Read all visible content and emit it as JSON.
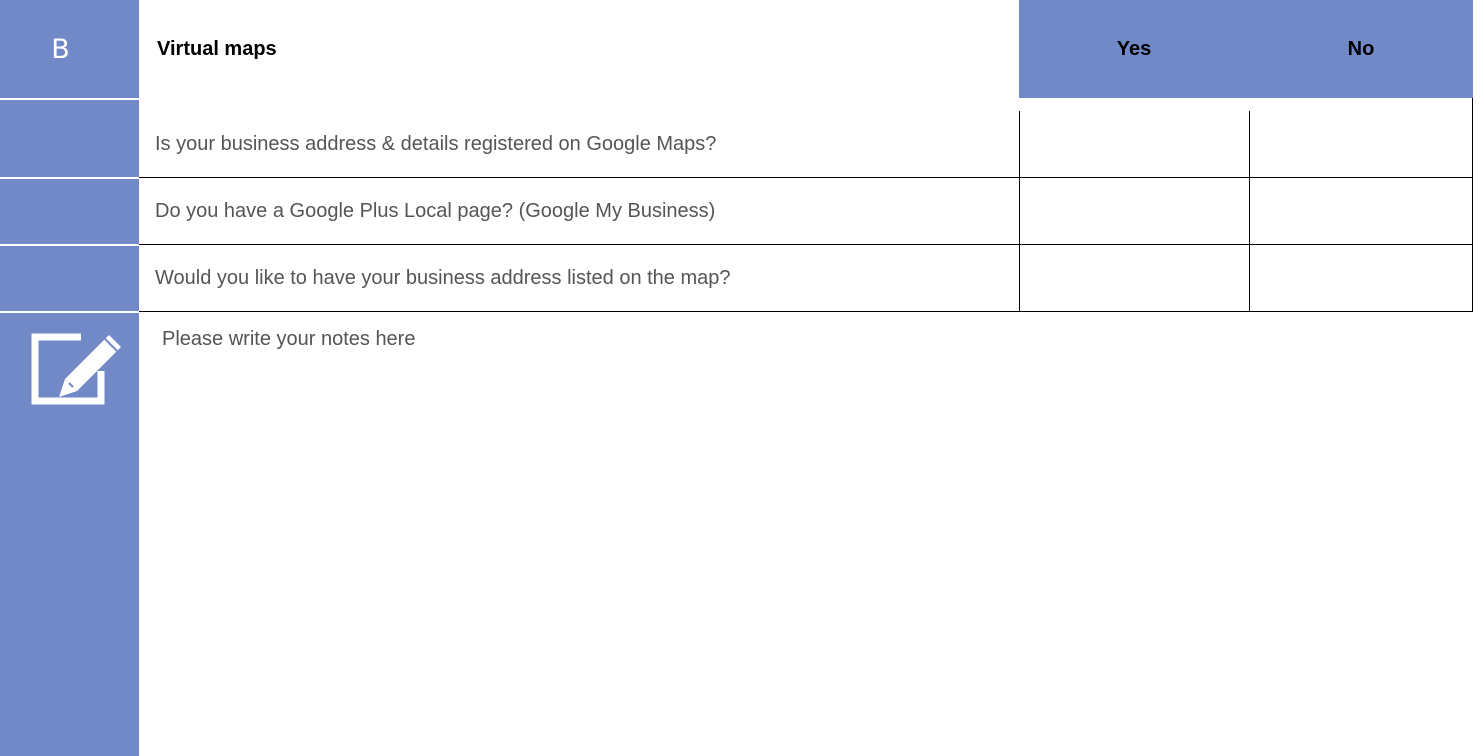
{
  "section": {
    "letter": "B",
    "title": "Virtual maps"
  },
  "columns": {
    "yes": "Yes",
    "no": "No"
  },
  "questions": [
    {
      "text": "Is your business address & details registered on Google Maps?",
      "yes": "",
      "no": ""
    },
    {
      "text": "Do you have a Google Plus Local page? (Google My Business)",
      "yes": "",
      "no": ""
    },
    {
      "text": "Would you like to have your business address listed on the map?",
      "yes": "",
      "no": ""
    }
  ],
  "notes": {
    "icon": "edit-note-icon",
    "placeholder": "Please write your notes here"
  },
  "colors": {
    "accent": "#7189c7",
    "question_text": "#555555"
  }
}
